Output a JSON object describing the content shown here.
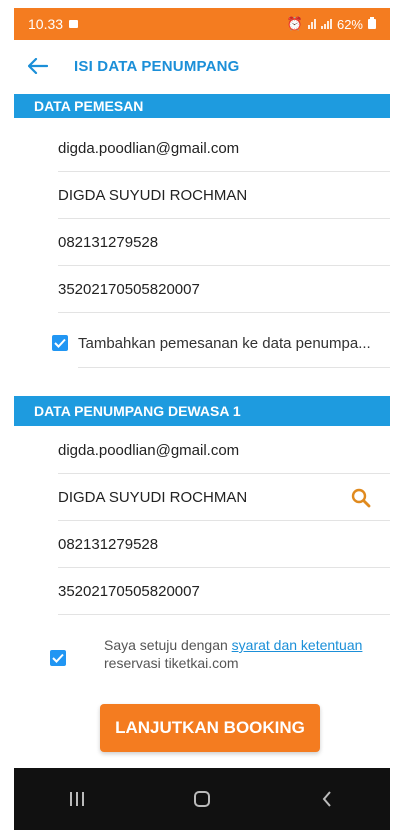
{
  "status_bar": {
    "time": "10.33",
    "battery": "62%"
  },
  "app_bar": {
    "title": "ISI DATA PENUMPANG",
    "back_icon": "arrow-left-icon"
  },
  "pemesan": {
    "header": "DATA PEMESAN",
    "email": "digda.poodlian@gmail.com",
    "name": "DIGDA SUYUDI ROCHMAN",
    "phone": "082131279528",
    "id_number": "35202170505820007",
    "add_checkbox_label": "Tambahkan pemesanan ke data penumpa...",
    "add_checked": true
  },
  "penumpang": {
    "header": "DATA PENUMPANG DEWASA 1",
    "email": "digda.poodlian@gmail.com",
    "name": "DIGDA SUYUDI ROCHMAN",
    "search_icon": "search-icon",
    "phone": "082131279528",
    "id_number": "35202170505820007"
  },
  "agreement": {
    "checked": true,
    "text_before": "Saya setuju dengan",
    "link_text": "syarat dan ketentuan",
    "text_after": "reservasi tiketkai.com"
  },
  "cta": {
    "label": "LANJUTKAN BOOKING"
  },
  "nav": {
    "recents_icon": "recents-icon",
    "home_icon": "home-icon",
    "back_icon": "back-icon"
  },
  "colors": {
    "brand_orange": "#f47c20",
    "header_blue": "#1e9bdf",
    "title_blue": "#1b8fd8",
    "checkbox_blue": "#2196f3"
  }
}
